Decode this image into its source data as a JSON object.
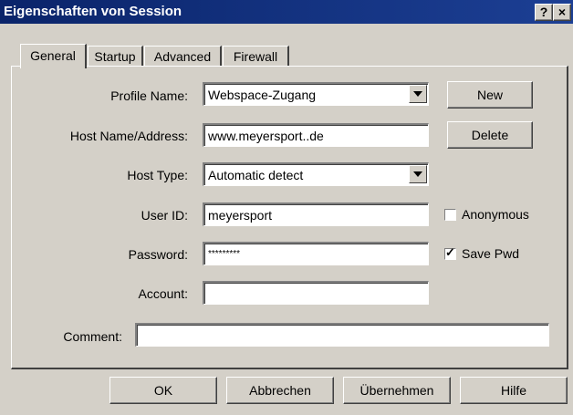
{
  "window": {
    "title": "Eigenschaften von Session",
    "help_button": "?",
    "close_button": "×"
  },
  "tabs": [
    "General",
    "Startup",
    "Advanced",
    "Firewall"
  ],
  "form": {
    "profile_name": {
      "label": "Profile Name:",
      "value": "Webspace-Zugang"
    },
    "host_name": {
      "label": "Host Name/Address:",
      "value": "www.meyersport..de"
    },
    "host_type": {
      "label": "Host Type:",
      "value": "Automatic detect"
    },
    "user_id": {
      "label": "User ID:",
      "value": "meyersport"
    },
    "password": {
      "label": "Password:",
      "value": "*********"
    },
    "account": {
      "label": "Account:",
      "value": ""
    },
    "comment": {
      "label": "Comment:",
      "value": ""
    }
  },
  "side_buttons": {
    "new": "New",
    "delete": "Delete"
  },
  "checkboxes": {
    "anonymous": {
      "label": "Anonymous",
      "checked": false
    },
    "save_pwd": {
      "label": "Save Pwd",
      "checked": true
    }
  },
  "footer_buttons": {
    "ok": "OK",
    "cancel": "Abbrechen",
    "apply": "Übernehmen",
    "help": "Hilfe"
  }
}
